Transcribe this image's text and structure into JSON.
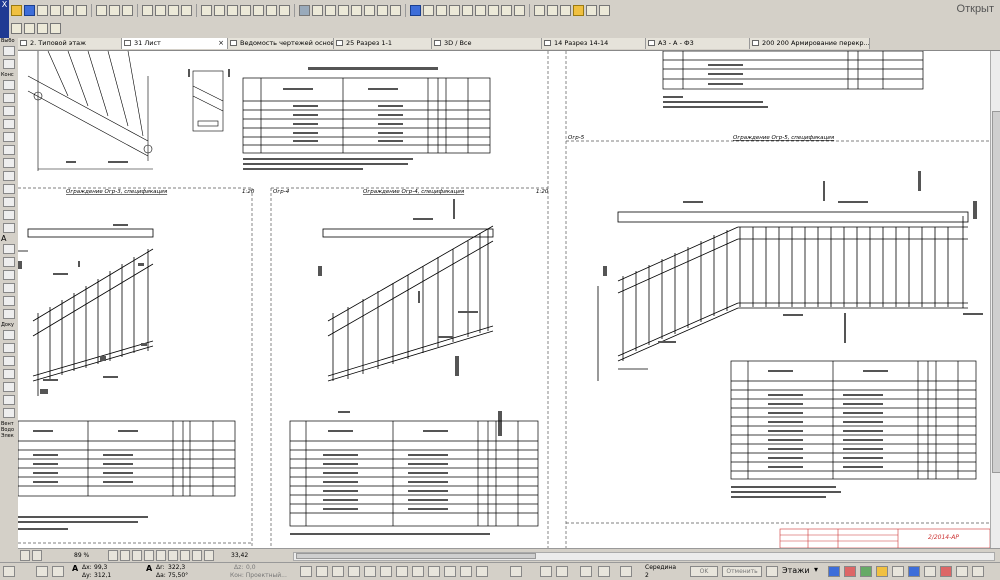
{
  "toolbar": {
    "open_label": "Открыт"
  },
  "toolbox": {
    "labels": [
      "Выбо",
      "Конс",
      "А",
      "Доку",
      "Вент",
      "Водо",
      "Элек"
    ]
  },
  "tabs": [
    {
      "label": "2. Типовой этаж",
      "closable": false
    },
    {
      "label": "31 Лист",
      "closable": true
    },
    {
      "label": "Ведомость чертежей основн...",
      "closable": false
    },
    {
      "label": "25 Разрез 1-1",
      "closable": false
    },
    {
      "label": "3D / Все",
      "closable": false
    },
    {
      "label": "14 Разрез 14-14",
      "closable": false
    },
    {
      "label": "А3 - А - Ф3",
      "closable": false
    },
    {
      "label": "200 200 Армирование перекр...",
      "closable": false
    }
  ],
  "drawings": {
    "ogr3_title": "Ограждение Огр-3, спецификация",
    "ogr3_scale": "1:20",
    "ogr4_label": "Огр-4",
    "ogr4_title": "Ограждение Огр-4, спецификация",
    "ogr4_scale": "1:20",
    "ogr5_label": "Огр-5",
    "ogr5_title": "Ограждение Огр-5, спецификация"
  },
  "stamp": {
    "number": "2/2014-АР"
  },
  "statusbar": {
    "zoom": "89 %",
    "angle_value": "33,42",
    "dx_label": "Δx:",
    "dx_value": "99,3",
    "dy_label": "Δy:",
    "dy_value": "312,1",
    "ar_label": "Δr:",
    "ar_value": "322,3",
    "aa_label": "Δa:",
    "aa_value": "75,50°",
    "z_label": "Δz:",
    "z_value": "0,0",
    "base_label": "Кон: Проектный...",
    "middle_label": "Середина",
    "middle_value": "2",
    "ok_label": "OK",
    "cancel_label": "Отменить",
    "floors_label": "Этажи"
  }
}
